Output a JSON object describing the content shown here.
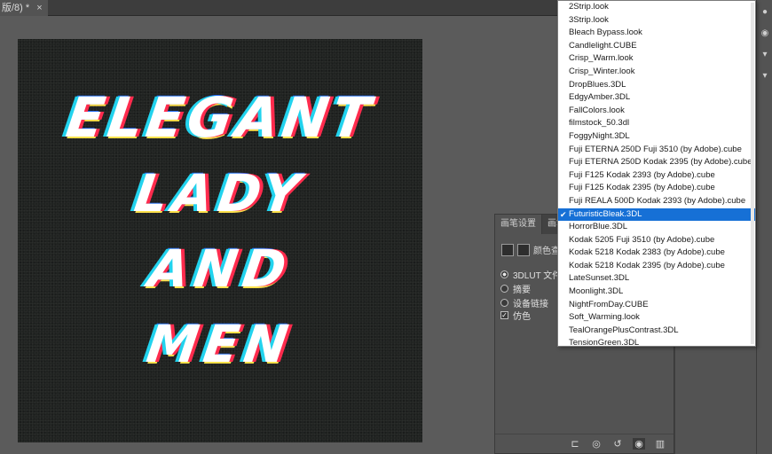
{
  "doc_tab": {
    "title": "版/8) *",
    "close": "×"
  },
  "canvas_text": [
    "ELEGANT",
    "LADY",
    "AND",
    "MEN"
  ],
  "adjust_panel": {
    "tabs": [
      "画笔设置",
      "画笔"
    ],
    "header_label": "颜色查",
    "options": [
      {
        "label": "3DLUT 文件",
        "type": "radio",
        "checked": true
      },
      {
        "label": "摘要",
        "type": "radio",
        "checked": false
      },
      {
        "label": "设备链接",
        "type": "radio",
        "checked": false
      },
      {
        "label": "仿色",
        "type": "checkbox",
        "checked": true
      }
    ],
    "footer_icons": [
      "clip-to-layer-icon",
      "view-previous-icon",
      "reset-icon",
      "visibility-icon",
      "delete-icon"
    ]
  },
  "lut_dropdown": {
    "selected": "FuturisticBleak.3DL",
    "items": [
      "2Strip.look",
      "3Strip.look",
      "Bleach Bypass.look",
      "Candlelight.CUBE",
      "Crisp_Warm.look",
      "Crisp_Winter.look",
      "DropBlues.3DL",
      "EdgyAmber.3DL",
      "FallColors.look",
      "filmstock_50.3dl",
      "FoggyNight.3DL",
      "Fuji ETERNA 250D Fuji 3510 (by Adobe).cube",
      "Fuji ETERNA 250D Kodak 2395 (by Adobe).cube",
      "Fuji F125 Kodak 2393 (by Adobe).cube",
      "Fuji F125 Kodak 2395 (by Adobe).cube",
      "Fuji REALA 500D Kodak 2393 (by Adobe).cube",
      "FuturisticBleak.3DL",
      "HorrorBlue.3DL",
      "Kodak 5205 Fuji 3510 (by Adobe).cube",
      "Kodak 5218 Kodak 2383 (by Adobe).cube",
      "Kodak 5218 Kodak 2395 (by Adobe).cube",
      "LateSunset.3DL",
      "Moonlight.3DL",
      "NightFromDay.CUBE",
      "Soft_Warming.look",
      "TealOrangePlusContrast.3DL",
      "TensionGreen.3DL"
    ]
  }
}
